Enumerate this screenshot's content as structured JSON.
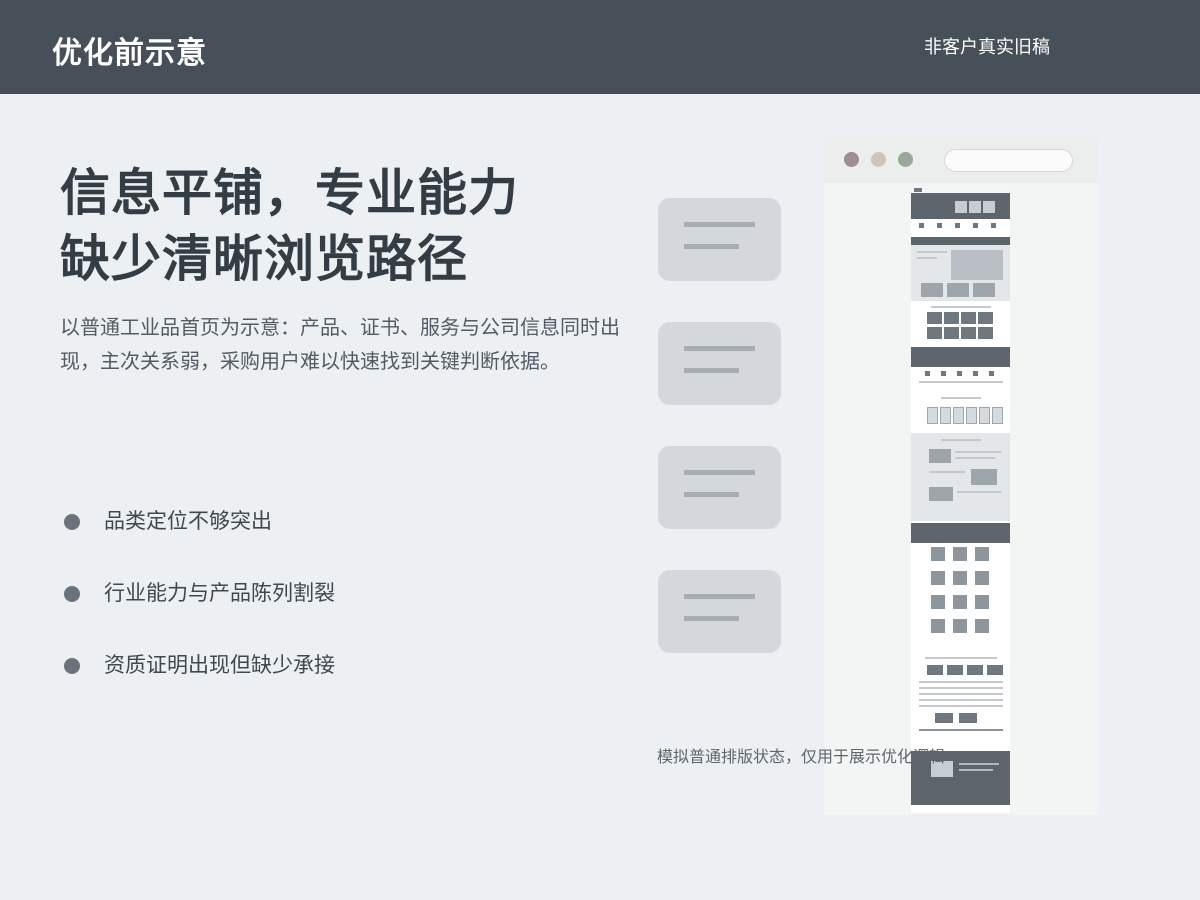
{
  "header": {
    "title": "优化前示意",
    "note": "非客户真实旧稿"
  },
  "main": {
    "headline_line1": "信息平铺，专业能力",
    "headline_line2": "缺少清晰浏览路径",
    "description": "以普通工业品首页为示意：产品、证书、服务与公司信息同时出现，主次关系弱，采购用户难以快速找到关键判断依据。",
    "bullets": [
      "品类定位不够突出",
      "行业能力与产品陈列割裂",
      "资质证明出现但缺少承接"
    ]
  },
  "illustration": {
    "caption": "模拟普通排版状态，仅用于展示优化逻辑"
  },
  "colors": {
    "header_bg": "#474F59",
    "page_bg": "#ECF0F3",
    "placeholder": "#D4D8DC"
  }
}
